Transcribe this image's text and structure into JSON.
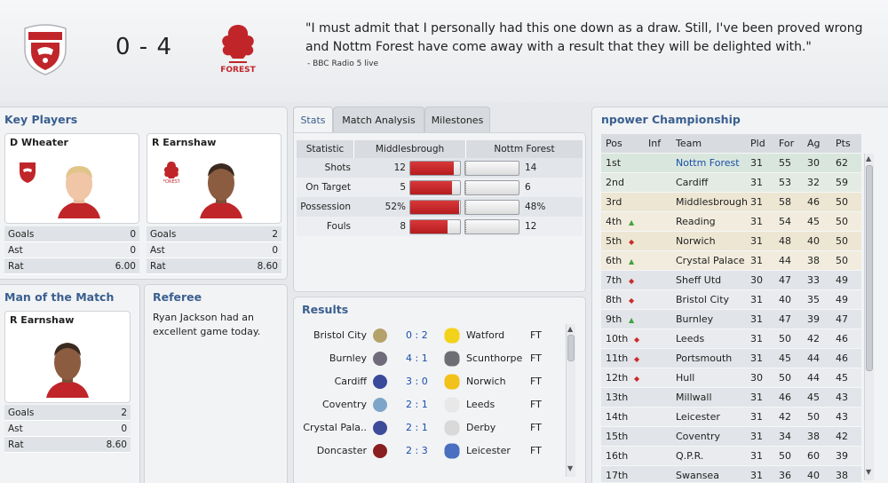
{
  "match": {
    "home_team": "Middlesbrough",
    "away_team": "Nottm Forest",
    "score": "0 - 4",
    "quote": "\"I must admit that I personally had this one down as a draw. Still, I've been proved wrong and Nottm Forest have come away with a result that they will be delighted with.\"",
    "quote_source": "- BBC Radio 5 live"
  },
  "key_players": {
    "title": "Key Players",
    "players": [
      {
        "name": "D Wheater",
        "stats": [
          {
            "label": "Goals",
            "value": "0"
          },
          {
            "label": "Ast",
            "value": "0"
          },
          {
            "label": "Rat",
            "value": "6.00"
          }
        ]
      },
      {
        "name": "R Earnshaw",
        "stats": [
          {
            "label": "Goals",
            "value": "2"
          },
          {
            "label": "Ast",
            "value": "0"
          },
          {
            "label": "Rat",
            "value": "8.60"
          }
        ]
      }
    ]
  },
  "motm": {
    "title": "Man of the Match",
    "name": "R Earnshaw",
    "stats": [
      {
        "label": "Goals",
        "value": "2"
      },
      {
        "label": "Ast",
        "value": "0"
      },
      {
        "label": "Rat",
        "value": "8.60"
      }
    ]
  },
  "referee": {
    "title": "Referee",
    "text": "Ryan Jackson had an excellent game today."
  },
  "tabs": [
    "Stats",
    "Match Analysis",
    "Milestones"
  ],
  "stats": {
    "headers": [
      "Statistic",
      "Middlesbrough",
      "Nottm Forest"
    ],
    "rows": [
      {
        "label": "Shots",
        "home": "12",
        "away": "14",
        "home_share": 0.46
      },
      {
        "label": "On Target",
        "home": "5",
        "away": "6",
        "home_share": 0.45
      },
      {
        "label": "Possession",
        "home": "52%",
        "away": "48%",
        "home_share": 0.52
      },
      {
        "label": "Fouls",
        "home": "8",
        "away": "12",
        "home_share": 0.4
      }
    ]
  },
  "results": {
    "title": "Results",
    "rows": [
      {
        "home": "Bristol City",
        "score": "0 : 2",
        "away": "Watford",
        "status": "FT"
      },
      {
        "home": "Burnley",
        "score": "4 : 1",
        "away": "Scunthorpe",
        "status": "FT"
      },
      {
        "home": "Cardiff",
        "score": "3 : 0",
        "away": "Norwich",
        "status": "FT"
      },
      {
        "home": "Coventry",
        "score": "2 : 1",
        "away": "Leeds",
        "status": "FT"
      },
      {
        "home": "Crystal Pala..",
        "score": "2 : 1",
        "away": "Derby",
        "status": "FT"
      },
      {
        "home": "Doncaster",
        "score": "2 : 3",
        "away": "Leicester",
        "status": "FT"
      }
    ]
  },
  "league": {
    "title": "npower Championship",
    "headers": [
      "Pos",
      "Inf",
      "Team",
      "Pld",
      "For",
      "Ag",
      "Pts"
    ],
    "rows": [
      {
        "pos": "1st",
        "inf": "",
        "team": "Nottm Forest",
        "pld": "31",
        "for": "55",
        "ag": "30",
        "pts": "62"
      },
      {
        "pos": "2nd",
        "inf": "",
        "team": "Cardiff",
        "pld": "31",
        "for": "53",
        "ag": "32",
        "pts": "59"
      },
      {
        "pos": "3rd",
        "inf": "",
        "team": "Middlesbrough",
        "pld": "31",
        "for": "58",
        "ag": "46",
        "pts": "50"
      },
      {
        "pos": "4th",
        "inf": "up",
        "team": "Reading",
        "pld": "31",
        "for": "54",
        "ag": "45",
        "pts": "50"
      },
      {
        "pos": "5th",
        "inf": "down",
        "team": "Norwich",
        "pld": "31",
        "for": "48",
        "ag": "40",
        "pts": "50"
      },
      {
        "pos": "6th",
        "inf": "up",
        "team": "Crystal Palace",
        "pld": "31",
        "for": "44",
        "ag": "38",
        "pts": "50"
      },
      {
        "pos": "7th",
        "inf": "down",
        "team": "Sheff Utd",
        "pld": "30",
        "for": "47",
        "ag": "33",
        "pts": "49"
      },
      {
        "pos": "8th",
        "inf": "down",
        "team": "Bristol City",
        "pld": "31",
        "for": "40",
        "ag": "35",
        "pts": "49"
      },
      {
        "pos": "9th",
        "inf": "up",
        "team": "Burnley",
        "pld": "31",
        "for": "47",
        "ag": "39",
        "pts": "47"
      },
      {
        "pos": "10th",
        "inf": "down",
        "team": "Leeds",
        "pld": "31",
        "for": "50",
        "ag": "42",
        "pts": "46"
      },
      {
        "pos": "11th",
        "inf": "down",
        "team": "Portsmouth",
        "pld": "31",
        "for": "45",
        "ag": "44",
        "pts": "46"
      },
      {
        "pos": "12th",
        "inf": "down",
        "team": "Hull",
        "pld": "30",
        "for": "50",
        "ag": "44",
        "pts": "45"
      },
      {
        "pos": "13th",
        "inf": "",
        "team": "Millwall",
        "pld": "31",
        "for": "46",
        "ag": "45",
        "pts": "43"
      },
      {
        "pos": "14th",
        "inf": "",
        "team": "Leicester",
        "pld": "31",
        "for": "42",
        "ag": "50",
        "pts": "43"
      },
      {
        "pos": "15th",
        "inf": "",
        "team": "Coventry",
        "pld": "31",
        "for": "34",
        "ag": "38",
        "pts": "42"
      },
      {
        "pos": "16th",
        "inf": "",
        "team": "Q.P.R.",
        "pld": "31",
        "for": "50",
        "ag": "60",
        "pts": "39"
      },
      {
        "pos": "17th",
        "inf": "",
        "team": "Swansea",
        "pld": "31",
        "for": "36",
        "ag": "40",
        "pts": "38"
      }
    ]
  },
  "colors": {
    "accent": "#3a5f8f",
    "link": "#1a4fa8",
    "home_red": "#c0252a",
    "promotion_bg": "#d9e6dd",
    "playoff_bg": "#ede6d3",
    "up_arrow": "#3fa33f",
    "down_arrow": "#cc2a2a"
  }
}
